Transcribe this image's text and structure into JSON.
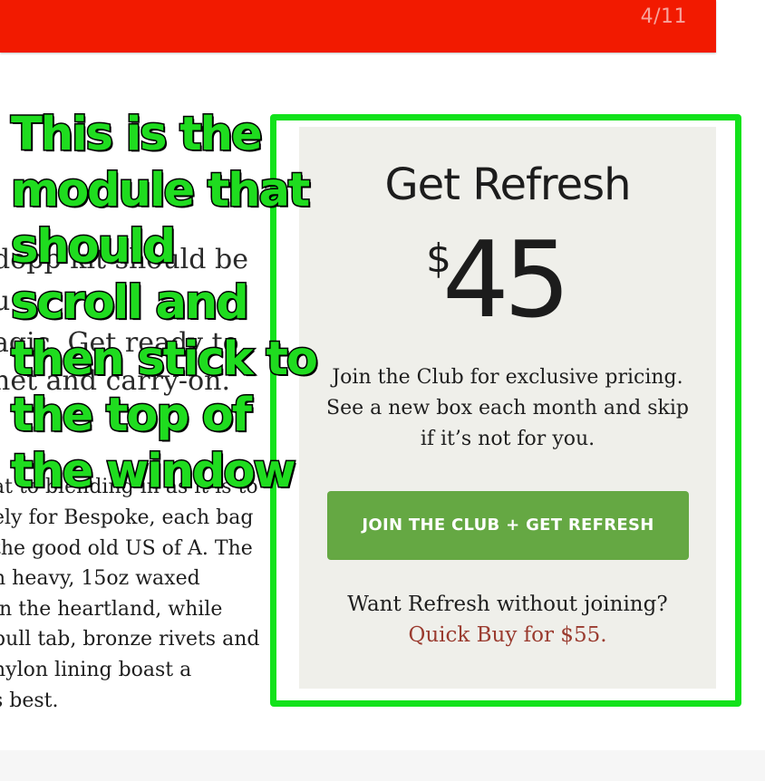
{
  "header": {
    "pager": "4/11"
  },
  "article": {
    "large_lines": [
      "dopp kit should be",
      "u",
      "agic. Get ready to",
      "net and carry-on."
    ],
    "small_lines": [
      "at to blending in as it is to",
      "ely for Bespoke, each bag",
      "the good old US of A. The",
      "n heavy, 15oz waxed",
      "in the heartland, while",
      "pull tab, bronze rivets and",
      " nylon lining boast a",
      "s best."
    ]
  },
  "module": {
    "title": "Get Refresh",
    "price_symbol": "$",
    "price_amount": "45",
    "description": "Join the Club for exclusive pricing. See a new box each month and skip if it’s not for you.",
    "cta_label": "JOIN THE CLUB + GET REFRESH",
    "quick_question": "Want Refresh without joining?",
    "quick_link": "Quick Buy for $55."
  },
  "annotation": {
    "lines": [
      "This is the",
      "module that",
      "should",
      "scroll and",
      "then stick to",
      "the top of",
      "the window"
    ]
  },
  "colors": {
    "header_red": "#f21a00",
    "annotation_green": "#1fdc1f",
    "cta_green": "#65a843",
    "link_red": "#9a3b2f",
    "module_bg": "#efefea"
  }
}
